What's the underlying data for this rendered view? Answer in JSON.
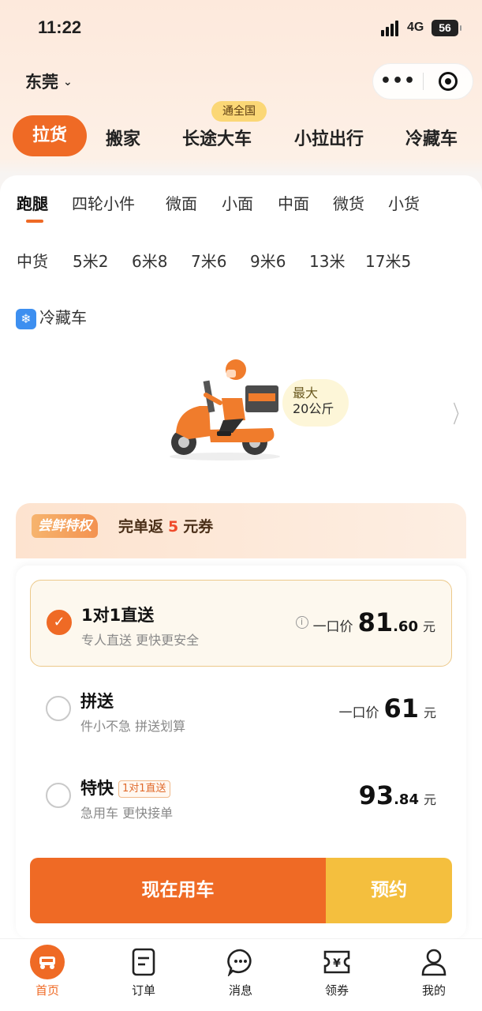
{
  "status_bar": {
    "time": "11:22",
    "network": "4G",
    "battery": "56"
  },
  "header": {
    "city": "东莞"
  },
  "service_tabs": {
    "badge": "通全国",
    "items": [
      {
        "label": "拉货",
        "active": true
      },
      {
        "label": "搬家"
      },
      {
        "label": "长途大车"
      },
      {
        "label": "小拉出行"
      },
      {
        "label": "冷藏车"
      }
    ]
  },
  "vehicle_types": {
    "row1": [
      "跑腿",
      "四轮小件",
      "微面",
      "小面",
      "中面",
      "微货",
      "小货"
    ],
    "row2": [
      "中货",
      "5米2",
      "6米8",
      "7米6",
      "9米6",
      "13米",
      "17米5"
    ],
    "cold": "冷藏车",
    "selected": "跑腿"
  },
  "vehicle": {
    "capacity_label": "最大",
    "capacity_value": "20公斤",
    "icon": "electric-scooter"
  },
  "promo": {
    "tag": "尝鲜特权",
    "prefix": "完单返",
    "amount": "5",
    "suffix": "元券"
  },
  "options": [
    {
      "title": "1对1直送",
      "subtitle": "专人直送 更快更安全",
      "price_label": "一口价",
      "price_int": "81",
      "price_frac": ".60",
      "unit": "元",
      "selected": true
    },
    {
      "title": "拼送",
      "subtitle": "件小不急 拼送划算",
      "price_label": "一口价",
      "price_int": "61",
      "price_frac": "",
      "unit": "元",
      "selected": false
    },
    {
      "title": "特快",
      "tag": "1对1直送",
      "subtitle": "急用车 更快接单",
      "price_label": "",
      "price_int": "93",
      "price_frac": ".84",
      "unit": "元",
      "selected": false
    }
  ],
  "actions": {
    "primary": "现在用车",
    "secondary": "预约"
  },
  "bottom_nav": [
    {
      "label": "首页",
      "icon": "truck-icon",
      "active": true
    },
    {
      "label": "订单",
      "icon": "order-icon"
    },
    {
      "label": "消息",
      "icon": "message-icon"
    },
    {
      "label": "领券",
      "icon": "coupon-icon"
    },
    {
      "label": "我的",
      "icon": "profile-icon"
    }
  ],
  "colors": {
    "accent": "#ef6a25",
    "secondary": "#f4bf3e",
    "badge": "#fbd776",
    "promo_amount": "#ef4a2b"
  }
}
